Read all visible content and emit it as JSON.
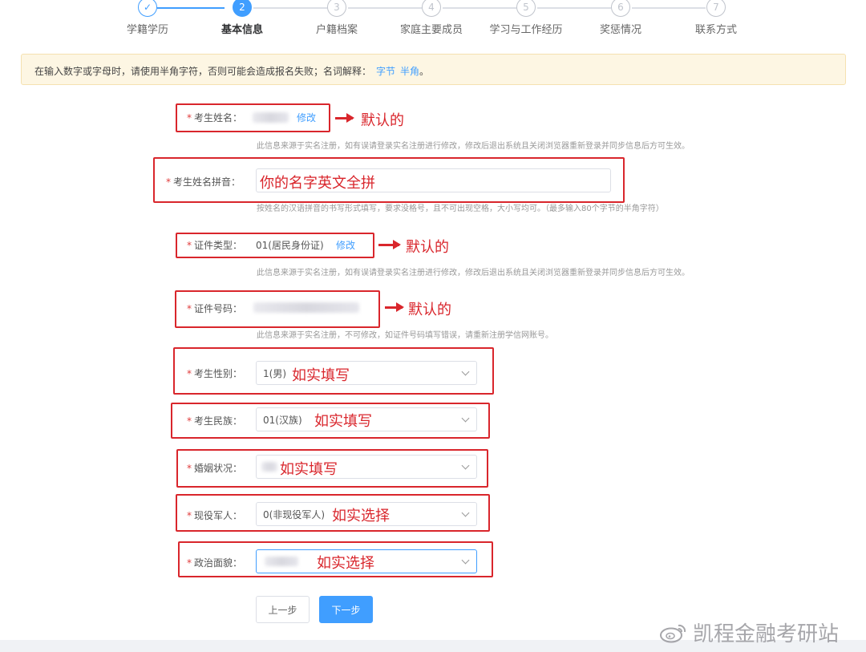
{
  "steps": [
    {
      "num": "✓",
      "label": "学籍学历",
      "state": "done"
    },
    {
      "num": "2",
      "label": "基本信息",
      "state": "active"
    },
    {
      "num": "3",
      "label": "户籍档案",
      "state": "todo"
    },
    {
      "num": "4",
      "label": "家庭主要成员",
      "state": "todo"
    },
    {
      "num": "5",
      "label": "学习与工作经历",
      "state": "todo"
    },
    {
      "num": "6",
      "label": "奖惩情况",
      "state": "todo"
    },
    {
      "num": "7",
      "label": "联系方式",
      "state": "todo"
    }
  ],
  "notice": {
    "text": "在输入数字或字母时，请使用半角字符，否则可能会造成报名失败；名词解释：",
    "link1": "字节",
    "link2": "半角",
    "end": "。"
  },
  "form": {
    "required_mark": "*",
    "name": {
      "label": "考生姓名：",
      "edit": "修改",
      "help": "此信息来源于实名注册，如有误请登录实名注册进行修改，修改后退出系统且关闭浏览器重新登录并同步信息后方可生效。"
    },
    "pinyin": {
      "label": "考生姓名拼音：",
      "help": "按姓名的汉语拼音的书写形式填写，要求没格号，且不可出现空格，大小写均可。（最多输入80个字节的半角字符）"
    },
    "id_type": {
      "label": "证件类型：",
      "value": "01(居民身份证)",
      "edit": "修改",
      "help": "此信息来源于实名注册，如有误请登录实名注册进行修改，修改后退出系统且关闭浏览器重新登录并同步信息后方可生效。"
    },
    "id_number": {
      "label": "证件号码：",
      "help": "此信息来源于实名注册，不可修改，如证件号码填写错误，请重新注册学信网账号。"
    },
    "gender": {
      "label": "考生性别：",
      "value": "1(男)"
    },
    "ethnicity": {
      "label": "考生民族：",
      "value": "01(汉族)"
    },
    "marital": {
      "label": "婚姻状况：",
      "value": ""
    },
    "military": {
      "label": "现役军人：",
      "value": "0(非现役军人)"
    },
    "political": {
      "label": "政治面貌：",
      "value": ""
    }
  },
  "annotations": {
    "default1": "默认的",
    "pinyin_hint": "你的名字英文全拼",
    "default2": "默认的",
    "default3": "默认的",
    "fill_gender": "如实填写",
    "fill_ethnicity": "如实填写",
    "fill_marital": "如实填写",
    "select_military": "如实选择",
    "select_political": "如实选择"
  },
  "buttons": {
    "prev": "上一步",
    "next": "下一步"
  },
  "watermark": "凯程金融考研站",
  "colors": {
    "primary": "#409eff",
    "annotation_red": "#d9262c",
    "notice_bg": "#fdf6e3"
  }
}
